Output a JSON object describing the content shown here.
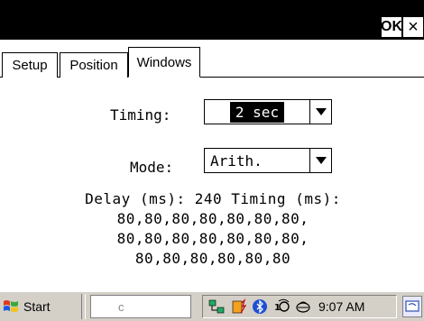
{
  "titlebar": {
    "ok_label": "OK",
    "close_label": "×"
  },
  "tabs": [
    {
      "label": "Setup",
      "active": false
    },
    {
      "label": "Position",
      "active": false
    },
    {
      "label": "Windows",
      "active": true
    }
  ],
  "form": {
    "timing_label": "Timing:",
    "timing_value": "2 sec",
    "mode_label": "Mode:",
    "mode_value": "Arith.",
    "delay_lines": [
      "Delay (ms): 240 Timing (ms):",
      "80,80,80,80,80,80,80,",
      "80,80,80,80,80,80,80,",
      "80,80,80,80,80,80"
    ]
  },
  "taskbar": {
    "start_label": "Start",
    "task_text": "c",
    "clock": "9:07 AM",
    "tray_icons": [
      "network-icon",
      "bluetooth-icon",
      "wifi-icon",
      "sync-icon"
    ]
  },
  "colors": {
    "titlebar_bg": "#000000",
    "taskbar_bg": "#d4d0c8",
    "selection_bg": "#000000"
  }
}
